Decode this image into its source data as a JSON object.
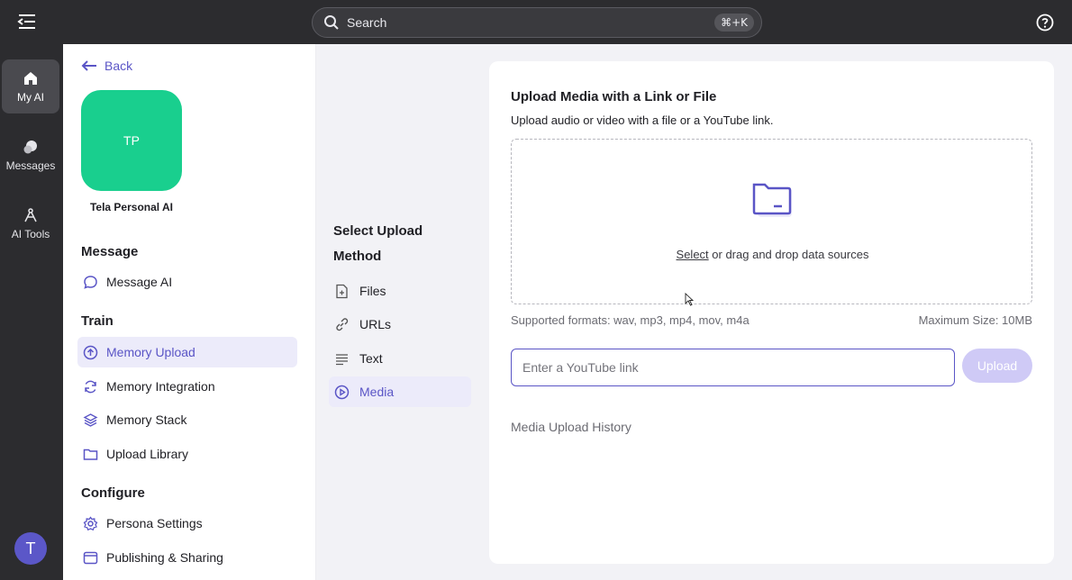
{
  "topbar": {
    "search_label": "Search",
    "search_shortcut": "⌘+K"
  },
  "rail": {
    "items": [
      {
        "label": "My AI",
        "icon": "home-icon"
      },
      {
        "label": "Messages",
        "icon": "messages-icon"
      },
      {
        "label": "AI Tools",
        "icon": "ai-tools-icon"
      }
    ],
    "user_initial": "T"
  },
  "nav": {
    "back_label": "Back",
    "ai_initials": "TP",
    "ai_name": "Tela Personal AI",
    "sections": {
      "message": "Message",
      "train": "Train",
      "configure": "Configure"
    },
    "items": {
      "message_ai": "Message AI",
      "memory_upload": "Memory Upload",
      "memory_integration": "Memory Integration",
      "memory_stack": "Memory Stack",
      "upload_library": "Upload Library",
      "persona_settings": "Persona Settings",
      "publishing_sharing": "Publishing & Sharing"
    }
  },
  "methods": {
    "title": "Select Upload Method",
    "items": [
      "Files",
      "URLs",
      "Text",
      "Media"
    ],
    "active": "Media"
  },
  "card": {
    "title": "Upload Media with a Link or File",
    "subtitle": "Upload audio or video with a file or a YouTube link.",
    "drop_select": "Select",
    "drop_rest": " or drag and drop data sources",
    "formats": "Supported formats: wav, mp3, mp4, mov, m4a",
    "max_size": "Maximum Size: 10MB",
    "youtube_placeholder": "Enter a YouTube link",
    "upload_button": "Upload",
    "history_label": "Media Upload History"
  },
  "colors": {
    "accent": "#5a55c6",
    "active_bg": "#ecebfa",
    "ai_avatar": "#19cf8e",
    "dark_bg": "#2c2c2f"
  }
}
